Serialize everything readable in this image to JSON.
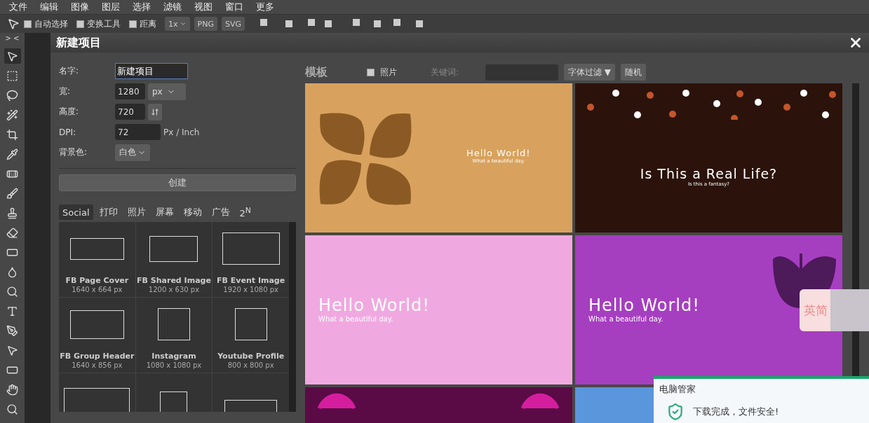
{
  "menu": [
    "文件",
    "编辑",
    "图像",
    "图层",
    "选择",
    "滤镜",
    "视图",
    "窗口",
    "更多"
  ],
  "toolbar": {
    "options": [
      {
        "label": "自动选择",
        "checked": false
      },
      {
        "label": "变换工具",
        "checked": false
      },
      {
        "label": "距离",
        "checked": false
      }
    ],
    "zoom": "1x",
    "export_buttons": [
      "PNG",
      "SVG"
    ]
  },
  "tool_panel_toggle": "> <",
  "dialog": {
    "title": "新建项目",
    "form": {
      "name_label": "名字:",
      "name_value": "新建项目",
      "width_label": "宽:",
      "width_value": "1280",
      "unit": "px",
      "height_label": "高度:",
      "height_value": "720",
      "dpi_label": "DPI:",
      "dpi_value": "72",
      "dpi_unit": "Px / Inch",
      "bg_label": "背景色:",
      "bg_value": "白色"
    },
    "create_button": "创建",
    "preset_tabs": [
      {
        "label": "Social",
        "selected": true
      },
      {
        "label": "打印",
        "selected": false
      },
      {
        "label": "照片",
        "selected": false
      },
      {
        "label": "屏幕",
        "selected": false
      },
      {
        "label": "移动",
        "selected": false
      },
      {
        "label": "广告",
        "selected": false
      },
      {
        "label": "2$^{N}$",
        "selected": false
      }
    ],
    "presets": [
      {
        "kind": "cover",
        "name": "FB Page Cover",
        "size": "1640 x 664 px"
      },
      {
        "kind": "landscape",
        "name": "FB Shared Image",
        "size": "1200 x 630 px"
      },
      {
        "kind": "wide",
        "name": "FB Event Image",
        "size": "1920 x 1080 px"
      },
      {
        "kind": "cover2",
        "name": "FB Group Header",
        "size": "1640 x 856 px"
      },
      {
        "kind": "square",
        "name": "Instagram",
        "size": "1080 x 1080 px"
      },
      {
        "kind": "square",
        "name": "Youtube Profile",
        "size": "800 x 800 px"
      },
      {
        "kind": "large"
      },
      {
        "kind": "portrait"
      },
      {
        "kind": "banner"
      }
    ],
    "templates_title": "模板",
    "photo_filter": {
      "label": "照片",
      "checked": false
    },
    "keyword_label": "关键词:",
    "font_filter": "字体过滤 ▼",
    "random_button": "随机",
    "templates": [
      {
        "kind": "flower",
        "color": "#d8a25e",
        "title": "Hello World!",
        "subtitle": "What a beautiful day."
      },
      {
        "kind": "dots",
        "color": "#2b130b",
        "title": "Is This a Real Life?",
        "subtitle": "Is this a fantasy?"
      },
      {
        "kind": "plain",
        "color": "#f0a9e0",
        "title": "Hello World!",
        "subtitle": "What a beautiful day."
      },
      {
        "kind": "tulip",
        "color": "#a63ec0",
        "title": "Hello World!",
        "subtitle": "What a beautiful day."
      },
      {
        "kind": "hearts",
        "color": "#5a0a45"
      },
      {
        "kind": "plain",
        "color": "#5a96dc"
      }
    ]
  },
  "ime_widget": {
    "label": "英简"
  },
  "notification": {
    "app": "电脑管家",
    "message": "下载完成，文件安全!"
  }
}
